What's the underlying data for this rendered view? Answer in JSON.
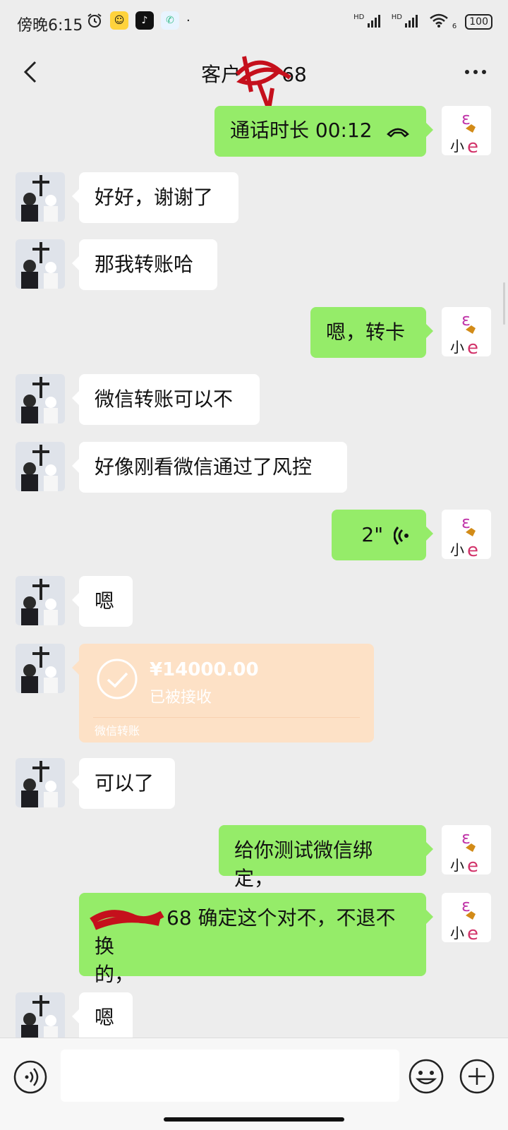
{
  "status_bar": {
    "time": "傍晚6:15",
    "signal1": "HD",
    "signal2": "HD",
    "wifi_sub": "6",
    "battery": "100"
  },
  "header": {
    "title": "客户",
    "title_suffix": "68"
  },
  "messages": [
    {
      "side": "out",
      "text": "通话时长 00:12"
    },
    {
      "side": "in",
      "text": "好好，谢谢了"
    },
    {
      "side": "in",
      "text": "那我转账哈"
    },
    {
      "side": "out",
      "text": "嗯，转卡"
    },
    {
      "side": "in",
      "text": "微信转账可以不"
    },
    {
      "side": "in",
      "text": "好像刚看微信通过了风控"
    },
    {
      "side": "out",
      "text": "2\""
    },
    {
      "side": "in",
      "text": "嗯"
    },
    {
      "side": "in",
      "type": "transfer",
      "amount": "¥14000.00",
      "status": "已被接收",
      "label": "微信转账"
    },
    {
      "side": "in",
      "text": "可以了"
    },
    {
      "side": "out",
      "text": "给你测试微信绑定，"
    },
    {
      "side": "out",
      "text": "68 确定这个对不，不退不换",
      "text2": "的，"
    },
    {
      "side": "in",
      "text": "嗯"
    }
  ],
  "avatar_text": "小",
  "colors": {
    "background": "#ededed",
    "outgoing_bubble": "#95ec69",
    "incoming_bubble": "#ffffff",
    "transfer_bubble": "#fde1c6"
  }
}
